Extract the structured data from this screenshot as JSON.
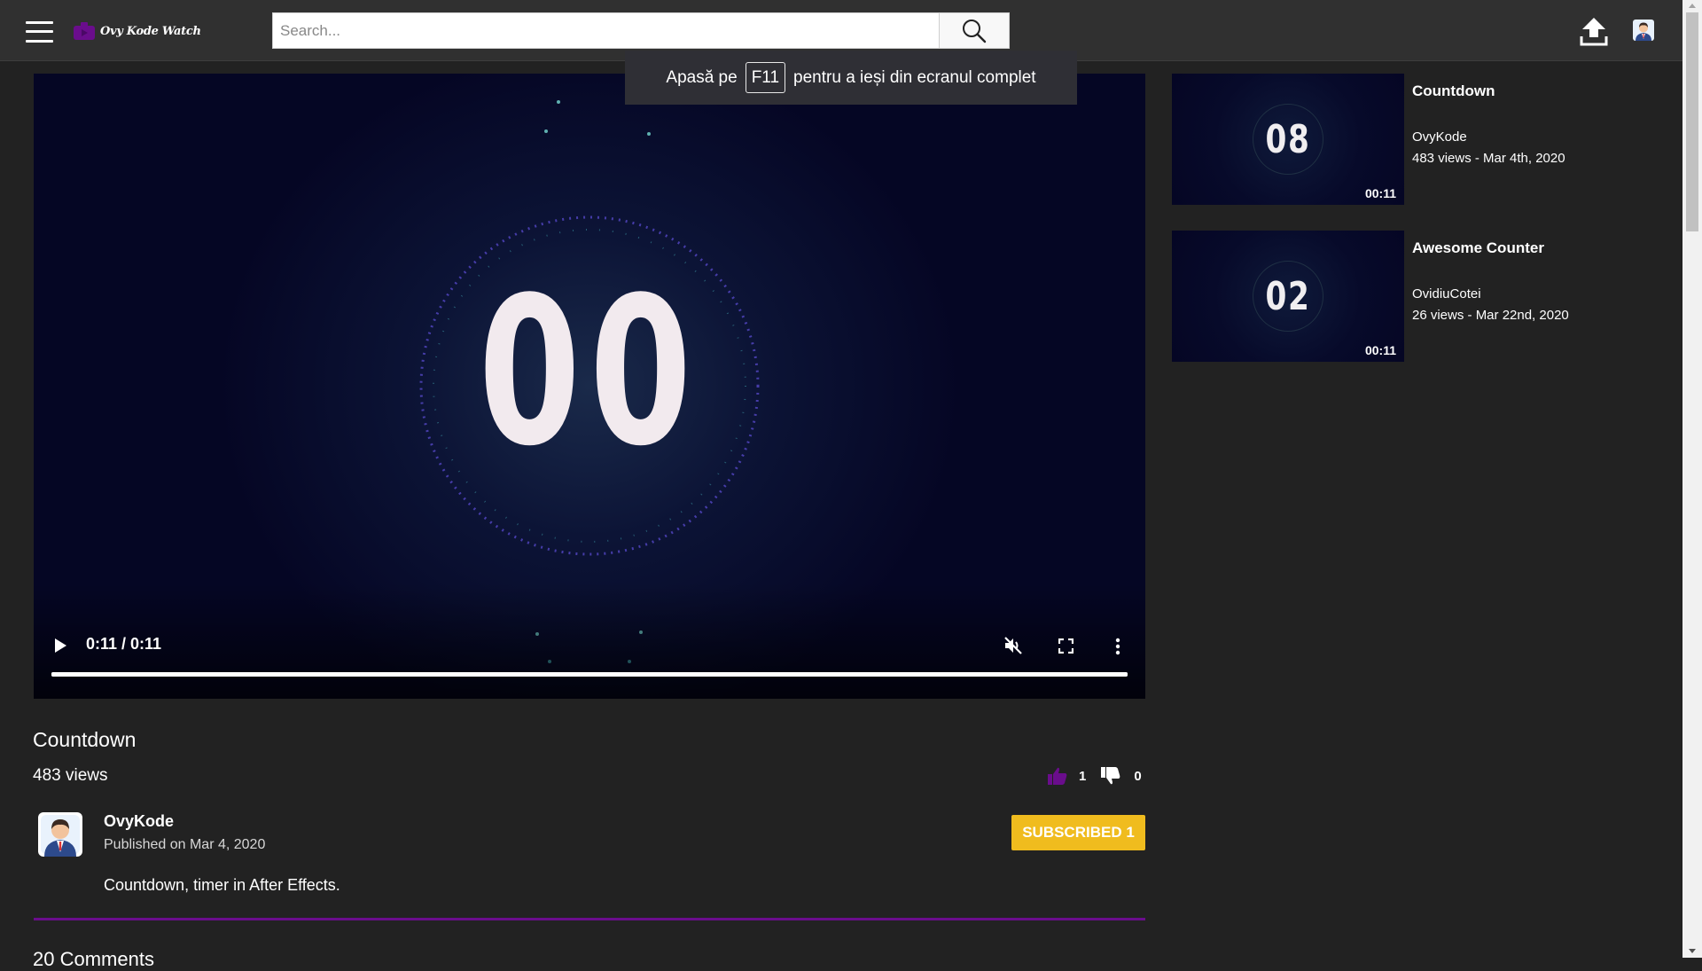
{
  "header": {
    "logo_text": "Ovy Kode Watch",
    "search_placeholder": "Search...",
    "icons": [
      "menu-icon",
      "logo-icon",
      "search-icon",
      "upload-icon",
      "user-avatar-icon"
    ]
  },
  "fullscreen_toast": {
    "before": "Apasă pe",
    "key": "F11",
    "after": "pentru a ieși din ecranul complet"
  },
  "player": {
    "display_digits": "00",
    "time": "0:11 / 0:11",
    "progress": 1.0,
    "muted": true,
    "icons": [
      "play-icon",
      "volume-muted-icon",
      "fullscreen-icon",
      "more-options-icon"
    ]
  },
  "video": {
    "title": "Countdown",
    "views": "483 views",
    "likes": "1",
    "dislikes": "0",
    "channel": "OvyKode",
    "published": "Published on Mar 4, 2020",
    "subscribe_label": "SUBSCRIBED 1",
    "description": "Countdown, timer in After Effects.",
    "comments_heading": "20 Comments"
  },
  "recommendations": [
    {
      "thumb_number": "08",
      "duration": "00:11",
      "title": "Countdown",
      "channel": "OvyKode",
      "meta": "483 views - Mar 4th, 2020"
    },
    {
      "thumb_number": "02",
      "duration": "00:11",
      "title": "Awesome Counter",
      "channel": "OvidiuCotei",
      "meta": "26 views - Mar 22nd, 2020"
    }
  ],
  "colors": {
    "page_bg": "#222222",
    "header_bg": "#303030",
    "accent_purple": "#6a0d8c",
    "subscribe_yellow": "#f0bc1e",
    "player_bg": "#050624"
  }
}
